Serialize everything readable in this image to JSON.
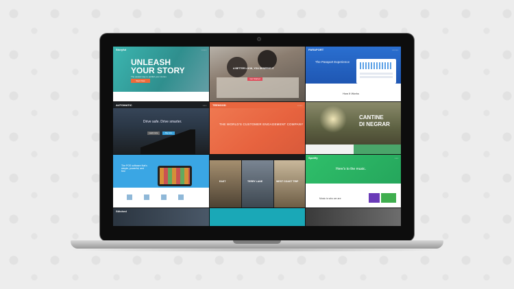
{
  "tiles": {
    "t1": {
      "logo": "Storyful",
      "headline1": "UNLEASH",
      "headline2": "YOUR STORY",
      "sub": "The easiest way to publish your stories",
      "cta": "Start Now"
    },
    "t2": {
      "headline": "A BETTER LOOK, YOU DESERVE IT",
      "cta": "Get Started"
    },
    "t3": {
      "logo": "PARAPORT",
      "title": "The Paraport Experience",
      "section": "How It Works"
    },
    "t4": {
      "logo": "AUTOMATIC",
      "headline": "Drive safe. Drive smarter.",
      "btn1": "Learn more",
      "btn2": "Buy now"
    },
    "t5": {
      "logo": "TEEHOOD",
      "headline": "THE WORLD'S CUSTOMER ENGAGEMENT COMPANY"
    },
    "t6": {
      "headline1": "CANTINE",
      "headline2": "DI NEGRAR"
    },
    "t7": {
      "headline": "The POS software that's simple, powerful, and free"
    },
    "t8": {
      "label1": "EAST",
      "label2": "TERRY LANE",
      "label3": "WEST COAST TRIP"
    },
    "t9": {
      "logo": "Spotify",
      "headline": "Here's to the music.",
      "sub": "Music is who we are"
    },
    "t10": {
      "logo": "Stitched"
    }
  }
}
